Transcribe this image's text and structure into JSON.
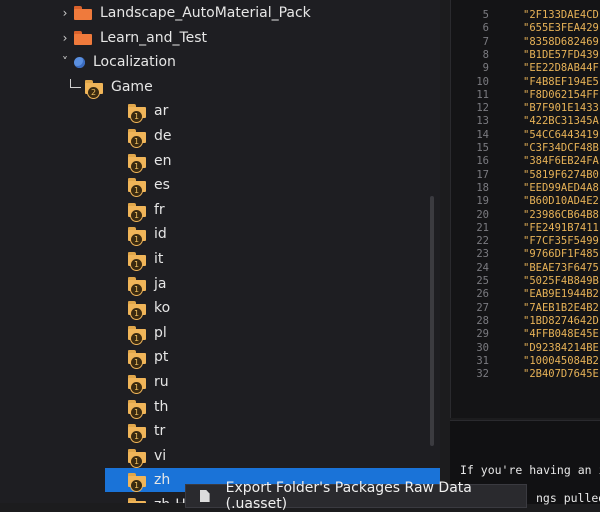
{
  "tree": {
    "items": [
      {
        "label": "Landscape_AutoMaterial_Pack",
        "indent": 0,
        "chevron": "›",
        "icon": "folder-icon",
        "icon_color": "orange"
      },
      {
        "label": "Learn_and_Test",
        "indent": 0,
        "chevron": "›",
        "icon": "folder-icon",
        "icon_color": "orange"
      },
      {
        "label": "Localization",
        "indent": 0,
        "chevron": "˅",
        "icon": "globe-icon"
      },
      {
        "label": "Game",
        "indent": 1,
        "chevron": "corner",
        "icon": "folder-icon",
        "badge": "2"
      },
      {
        "label": "ar",
        "indent": 2,
        "icon": "folder-icon",
        "badge": "1"
      },
      {
        "label": "de",
        "indent": 2,
        "icon": "folder-icon",
        "badge": "1"
      },
      {
        "label": "en",
        "indent": 2,
        "icon": "folder-icon",
        "badge": "1"
      },
      {
        "label": "es",
        "indent": 2,
        "icon": "folder-icon",
        "badge": "1"
      },
      {
        "label": "fr",
        "indent": 2,
        "icon": "folder-icon",
        "badge": "1"
      },
      {
        "label": "id",
        "indent": 2,
        "icon": "folder-icon",
        "badge": "1"
      },
      {
        "label": "it",
        "indent": 2,
        "icon": "folder-icon",
        "badge": "1"
      },
      {
        "label": "ja",
        "indent": 2,
        "icon": "folder-icon",
        "badge": "1"
      },
      {
        "label": "ko",
        "indent": 2,
        "icon": "folder-icon",
        "badge": "1"
      },
      {
        "label": "pl",
        "indent": 2,
        "icon": "folder-icon",
        "badge": "1"
      },
      {
        "label": "pt",
        "indent": 2,
        "icon": "folder-icon",
        "badge": "1"
      },
      {
        "label": "ru",
        "indent": 2,
        "icon": "folder-icon",
        "badge": "1"
      },
      {
        "label": "th",
        "indent": 2,
        "icon": "folder-icon",
        "badge": "1"
      },
      {
        "label": "tr",
        "indent": 2,
        "icon": "folder-icon",
        "badge": "1"
      },
      {
        "label": "vi",
        "indent": 2,
        "icon": "folder-icon",
        "badge": "1"
      },
      {
        "label": "zh",
        "indent": 2,
        "icon": "folder-icon",
        "badge": "1",
        "selected": true
      },
      {
        "label": "zh-H",
        "indent": 2,
        "icon": "folder-icon",
        "badge": "1"
      }
    ]
  },
  "code": {
    "lines": [
      {
        "n": "5",
        "v": "\"2F133DAE4CD"
      },
      {
        "n": "6",
        "v": "\"655E3FEA429"
      },
      {
        "n": "7",
        "v": "\"8358D682469"
      },
      {
        "n": "8",
        "v": "\"B1DE57FD439"
      },
      {
        "n": "9",
        "v": "\"EE22D8AB44F"
      },
      {
        "n": "10",
        "v": "\"F4B8EF194E5"
      },
      {
        "n": "11",
        "v": "\"F8D062154FF"
      },
      {
        "n": "12",
        "v": "\"B7F901E1433"
      },
      {
        "n": "13",
        "v": "\"422BC31345A"
      },
      {
        "n": "14",
        "v": "\"54CC6443419"
      },
      {
        "n": "15",
        "v": "\"C3F34DCF48B"
      },
      {
        "n": "16",
        "v": "\"384F6EB24FA"
      },
      {
        "n": "17",
        "v": "\"5819F6274B0"
      },
      {
        "n": "18",
        "v": "\"EED99AED4A8"
      },
      {
        "n": "19",
        "v": "\"B60D10AD4E2"
      },
      {
        "n": "20",
        "v": "\"23986CB64B8"
      },
      {
        "n": "21",
        "v": "\"FE2491B7411"
      },
      {
        "n": "22",
        "v": "\"F7CF35F5499"
      },
      {
        "n": "23",
        "v": "\"9766DF1F485"
      },
      {
        "n": "24",
        "v": "\"BEAE73F6475"
      },
      {
        "n": "25",
        "v": "\"5025F4B849B"
      },
      {
        "n": "26",
        "v": "\"EAB9E1944B2"
      },
      {
        "n": "27",
        "v": "\"7AEB1B2E4B2"
      },
      {
        "n": "28",
        "v": "\"1BD8274642D"
      },
      {
        "n": "29",
        "v": "\"4FFB048E45E"
      },
      {
        "n": "30",
        "v": "\"D92384214BE"
      },
      {
        "n": "31",
        "v": "\"100045084B2"
      },
      {
        "n": "32",
        "v": "\"2B407D7645E"
      }
    ]
  },
  "console": {
    "line1": "If you're having an i",
    "line2": "ngs pulled"
  },
  "context_menu": {
    "item_label": "Export Folder's Packages Raw Data (.uasset)",
    "item_icon": "export-file-icon"
  }
}
